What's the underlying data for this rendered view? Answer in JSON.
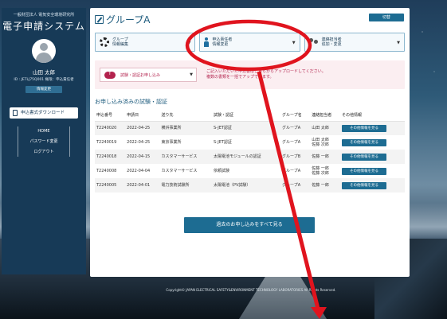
{
  "sidebar": {
    "org": "一般財団法人 電気安全環境研究所",
    "system_title": "電子申請システム",
    "user_name": "山田 太郎",
    "user_id": "ID : JETLJ75Q001  権限：申込責任者",
    "edit_info_label": "情報変更",
    "download_label": "申込書式ダウンロード",
    "nav": [
      "HOME",
      "パスワード変更",
      "ログアウト"
    ]
  },
  "main": {
    "title": "グループA",
    "switch_label": "切替",
    "selectors": [
      {
        "label": "グループ\n情報編集",
        "icon": "gear-icon"
      },
      {
        "label": "申込責任者\n情報変更",
        "icon": "person-icon"
      },
      {
        "label": "連絡担当者\n追加・変更",
        "icon": "people-icon"
      }
    ],
    "upload": {
      "select_label": "試験・認証お申し込み",
      "text": "ご記入いただいた申込書はこちらからアップロードしてください。\n複数の書類を一括でアップできます。"
    },
    "section_title": "お申し込み済みの試験・認証",
    "table": {
      "headers": [
        "申込番号",
        "申請日",
        "送り先",
        "試験・認証",
        "グループ名",
        "連絡担当者",
        "その他情報"
      ],
      "rows": [
        [
          "T2240020",
          "2022-04-25",
          "横浜事業所",
          "S-JET認証",
          "グループA",
          "山田 太郎",
          "その他情報を見る"
        ],
        [
          "T2240019",
          "2022-04-25",
          "東京事業所",
          "S-JET認証",
          "グループA",
          "山田 太郎\n佐藤 次郎",
          "その他情報を見る"
        ],
        [
          "T2240018",
          "2022-04-15",
          "カスタマーサービス",
          "太陽電池モジュールの認証",
          "グループB",
          "佐藤 一郎",
          "その他情報を見る"
        ],
        [
          "T2240008",
          "2022-04-04",
          "カスタマーサービス",
          "依頼試験",
          "グループA",
          "佐藤 一郎\n佐藤 次郎",
          "その他情報を見る"
        ],
        [
          "T2240005",
          "2022-04-01",
          "電力技術試験所",
          "太陽電池（PV試験）",
          "グループA",
          "佐藤 一郎",
          "その他情報を見る"
        ]
      ]
    },
    "view_all_label": "過去のお申し込みをすべて見る"
  },
  "footer": "Copyright© JAPAN ELECTRICAL SAFETY&ENVIRONMENT TECHNOLOGY LABORATORIES All Rights Reserved.",
  "colors": {
    "accent": "#1d6c92",
    "sidebar": "#173a57",
    "annotation": "#e0141e",
    "upload_bg": "#fbeef1"
  }
}
